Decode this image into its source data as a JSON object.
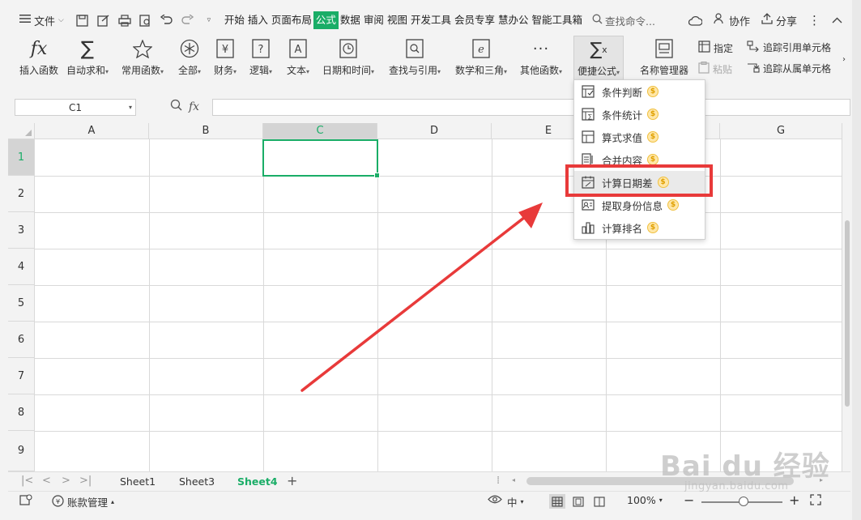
{
  "topbar": {
    "file_label": "文件",
    "tabs": [
      "开始",
      "插入",
      "页面布局",
      "公式",
      "数据",
      "审阅",
      "视图",
      "开发工具",
      "会员专享",
      "慧办公",
      "智能工具箱"
    ],
    "active_tab": "公式",
    "search_placeholder": "查找命令...",
    "collab_label": "协作",
    "share_label": "分享"
  },
  "ribbon": {
    "insert_func": "插入函数",
    "autosum": "自动求和",
    "common_func": "常用函数",
    "all": "全部",
    "finance": "财务",
    "logic": "逻辑",
    "text": "文本",
    "datetime": "日期和时间",
    "lookup": "查找与引用",
    "math": "数学和三角",
    "other_func": "其他函数",
    "quick_formula": "便捷公式",
    "name_manager": "名称管理器",
    "specify": "指定",
    "paste": "粘贴",
    "trace_precedents": "追踪引用单元格",
    "trace_dependents": "追踪从属单元格"
  },
  "formula_bar": {
    "cell_ref": "C1",
    "fx": "fx"
  },
  "grid": {
    "columns": [
      "A",
      "B",
      "C",
      "D",
      "E",
      "F",
      "G"
    ],
    "rows": [
      "1",
      "2",
      "3",
      "4",
      "5",
      "6",
      "7",
      "8",
      "9"
    ],
    "selected_cell": "C1"
  },
  "menu": {
    "items": [
      {
        "label": "条件判断",
        "icon": "condition-icon"
      },
      {
        "label": "条件统计",
        "icon": "stats-icon"
      },
      {
        "label": "算式求值",
        "icon": "calc-icon"
      },
      {
        "label": "合并内容",
        "icon": "merge-icon"
      },
      {
        "label": "计算日期差",
        "icon": "calendar-icon"
      },
      {
        "label": "提取身份信息",
        "icon": "id-card-icon"
      },
      {
        "label": "计算排名",
        "icon": "ranking-icon"
      }
    ],
    "highlighted": "计算日期差",
    "coin_glyph": "$"
  },
  "sheets": {
    "tabs": [
      "Sheet1",
      "Sheet3",
      "Sheet4"
    ],
    "active": "Sheet4"
  },
  "status": {
    "account_label": "账款管理",
    "zoom": "100%"
  },
  "colors": {
    "accent": "#1aad67",
    "highlight_red": "#e83a3a"
  },
  "watermark": {
    "brand": "Bai du 经验",
    "url": "jingyan.baidu.com"
  }
}
